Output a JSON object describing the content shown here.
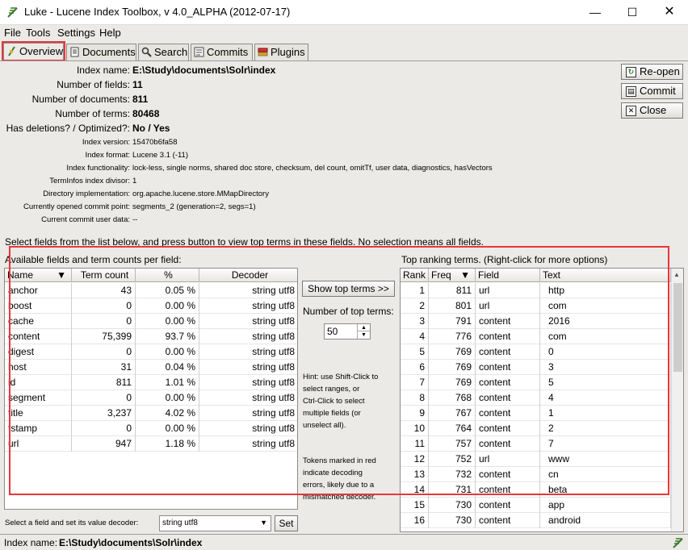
{
  "window": {
    "title": "Luke - Lucene Index Toolbox, v 4.0_ALPHA (2012-07-17)",
    "minimize": "—",
    "maximize": "☐",
    "close": "✕"
  },
  "menu": [
    "File",
    "Tools",
    "Settings",
    "Help"
  ],
  "tabs": [
    "Overview",
    "Documents",
    "Search",
    "Commits",
    "Plugins"
  ],
  "overview": {
    "index_name_label": "Index name:",
    "index_name": "E:\\Study\\documents\\Solr\\index",
    "num_fields_label": "Number of fields:",
    "num_fields": "11",
    "num_docs_label": "Number of documents:",
    "num_docs": "811",
    "num_terms_label": "Number of terms:",
    "num_terms": "80468",
    "deletions_label": "Has deletions? / Optimized?:",
    "deletions": "No / Yes",
    "version_label": "Index version:",
    "version": "15470b6fa58",
    "format_label": "Index format:",
    "format": "Lucene 3.1 (-11)",
    "functionality_label": "Index functionality:",
    "functionality": "lock-less, single norms, shared doc store, checksum, del count, omitTf, user data, diagnostics, hasVectors",
    "divisor_label": "TermInfos index divisor:",
    "divisor": "1",
    "directory_label": "Directory implementation:",
    "directory": "org.apache.lucene.store.MMapDirectory",
    "commit_point_label": "Currently opened commit point:",
    "commit_point": "segments_2 (generation=2, segs=1)",
    "user_data_label": "Current commit user data:",
    "user_data": "--"
  },
  "side_buttons": [
    "Re-open",
    "Commit",
    "Close"
  ],
  "select_fields_text": "Select fields from the list below, and press button to view top terms in these fields. No selection means all fields.",
  "fields_table": {
    "caption": "Available fields and term counts per field:",
    "columns": [
      "Name",
      "Term count",
      "%",
      "Decoder"
    ],
    "rows": [
      [
        "anchor",
        "43",
        "0.05 %",
        "string utf8"
      ],
      [
        "boost",
        "0",
        "0.00 %",
        "string utf8"
      ],
      [
        "cache",
        "0",
        "0.00 %",
        "string utf8"
      ],
      [
        "content",
        "75,399",
        "93.7 %",
        "string utf8"
      ],
      [
        "digest",
        "0",
        "0.00 %",
        "string utf8"
      ],
      [
        "host",
        "31",
        "0.04 %",
        "string utf8"
      ],
      [
        "id",
        "811",
        "1.01 %",
        "string utf8"
      ],
      [
        "segment",
        "0",
        "0.00 %",
        "string utf8"
      ],
      [
        "title",
        "3,237",
        "4.02 %",
        "string utf8"
      ],
      [
        "tstamp",
        "0",
        "0.00 %",
        "string utf8"
      ],
      [
        "url",
        "947",
        "1.18 %",
        "string utf8"
      ]
    ]
  },
  "middle": {
    "show_top_terms": "Show top terms >>",
    "num_top_terms_label": "Number of top terms:",
    "num_top_terms": "50",
    "hint1": [
      "Hint: use Shift-Click to",
      "select ranges, or",
      "Ctrl-Click to select",
      "multiple fields (or",
      "unselect all)."
    ],
    "hint2": [
      "Tokens marked in red",
      "indicate decoding",
      "errors, likely due to a",
      "mismatched decoder."
    ]
  },
  "terms_table": {
    "caption": "Top ranking terms. (Right-click for more options)",
    "columns": [
      "Rank",
      "Freq",
      "Field",
      "Text"
    ],
    "rows": [
      [
        "1",
        "811",
        "url",
        "http"
      ],
      [
        "2",
        "801",
        "url",
        "com"
      ],
      [
        "3",
        "791",
        "content",
        "2016"
      ],
      [
        "4",
        "776",
        "content",
        "com"
      ],
      [
        "5",
        "769",
        "content",
        "0"
      ],
      [
        "6",
        "769",
        "content",
        "3"
      ],
      [
        "7",
        "769",
        "content",
        "5"
      ],
      [
        "8",
        "768",
        "content",
        "4"
      ],
      [
        "9",
        "767",
        "content",
        "1"
      ],
      [
        "10",
        "764",
        "content",
        "2"
      ],
      [
        "11",
        "757",
        "content",
        "7"
      ],
      [
        "12",
        "752",
        "url",
        "www"
      ],
      [
        "13",
        "732",
        "content",
        "cn"
      ],
      [
        "14",
        "731",
        "content",
        "beta"
      ],
      [
        "15",
        "730",
        "content",
        "app"
      ],
      [
        "16",
        "730",
        "content",
        "android"
      ]
    ]
  },
  "decoder": {
    "label": "Select a field and set its value decoder:",
    "value": "string utf8",
    "set_button": "Set"
  },
  "status": {
    "label": "Index name:",
    "value": "E:\\Study\\documents\\Solr\\index"
  },
  "colors": {
    "highlight": "#e8363b",
    "panel": "#eceae6"
  }
}
